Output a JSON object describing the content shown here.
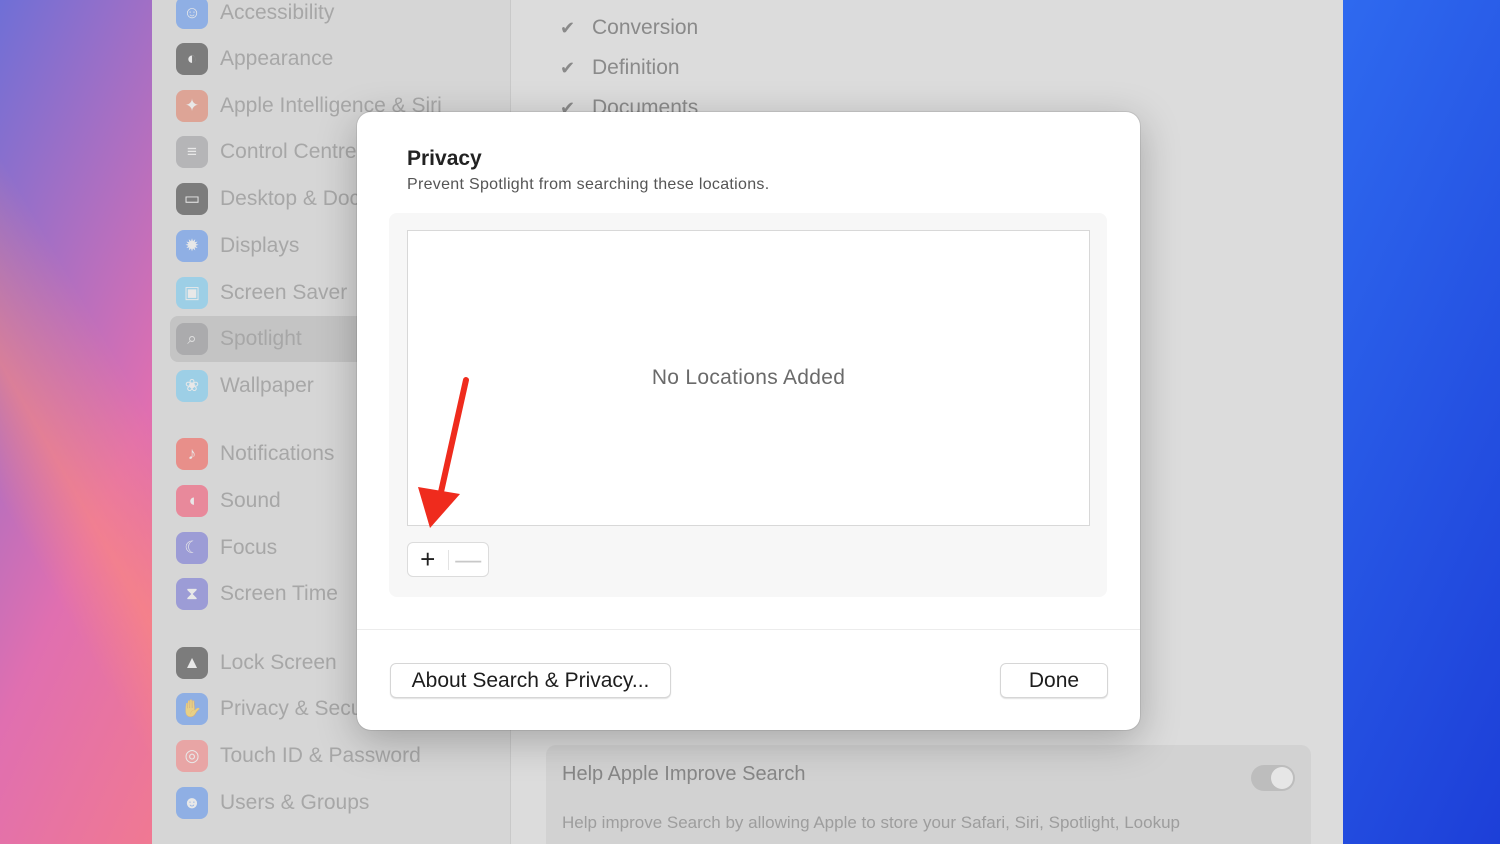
{
  "sidebar": {
    "items": [
      {
        "label": "Accessibility",
        "icon": "accessibility-icon",
        "color": "#3b82f6"
      },
      {
        "label": "Appearance",
        "icon": "appearance-icon",
        "color": "#111111"
      },
      {
        "label": "Apple Intelligence & Siri",
        "icon": "siri-icon",
        "color": "#e7694a"
      },
      {
        "label": "Control Centre",
        "icon": "control-centre-icon",
        "color": "#8e8e93"
      },
      {
        "label": "Desktop & Dock",
        "icon": "dock-icon",
        "color": "#111111"
      },
      {
        "label": "Displays",
        "icon": "displays-icon",
        "color": "#3b82f6"
      },
      {
        "label": "Screen Saver",
        "icon": "screen-saver-icon",
        "color": "#5ac8fa"
      },
      {
        "label": "Spotlight",
        "icon": "spotlight-icon",
        "color": "#8e8e93"
      },
      {
        "label": "Wallpaper",
        "icon": "wallpaper-icon",
        "color": "#5ac8fa"
      },
      {
        "label": "Notifications",
        "icon": "notifications-icon",
        "color": "#ff3b30"
      },
      {
        "label": "Sound",
        "icon": "sound-icon",
        "color": "#ff2d55"
      },
      {
        "label": "Focus",
        "icon": "focus-icon",
        "color": "#5856d6"
      },
      {
        "label": "Screen Time",
        "icon": "screen-time-icon",
        "color": "#5856d6"
      },
      {
        "label": "Lock Screen",
        "icon": "lock-icon",
        "color": "#111111"
      },
      {
        "label": "Privacy & Security",
        "icon": "privacy-hand-icon",
        "color": "#3b82f6"
      },
      {
        "label": "Touch ID & Password",
        "icon": "fingerprint-icon",
        "color": "#ff6b6b"
      },
      {
        "label": "Users & Groups",
        "icon": "users-icon",
        "color": "#3b82f6"
      }
    ]
  },
  "content": {
    "checks": [
      "Conversion",
      "Definition",
      "Documents"
    ],
    "help": {
      "title": "Help Apple Improve Search",
      "description": "Help improve Search by allowing Apple to store your Safari, Siri, Spotlight, Lookup"
    }
  },
  "dialog": {
    "title": "Privacy",
    "subtitle": "Prevent Spotlight from searching these locations.",
    "empty_text": "No Locations Added",
    "add_label": "+",
    "remove_label": "—",
    "about_label": "About Search & Privacy...",
    "done_label": "Done"
  },
  "annotation": {
    "arrow_color": "#ef2b1d"
  }
}
